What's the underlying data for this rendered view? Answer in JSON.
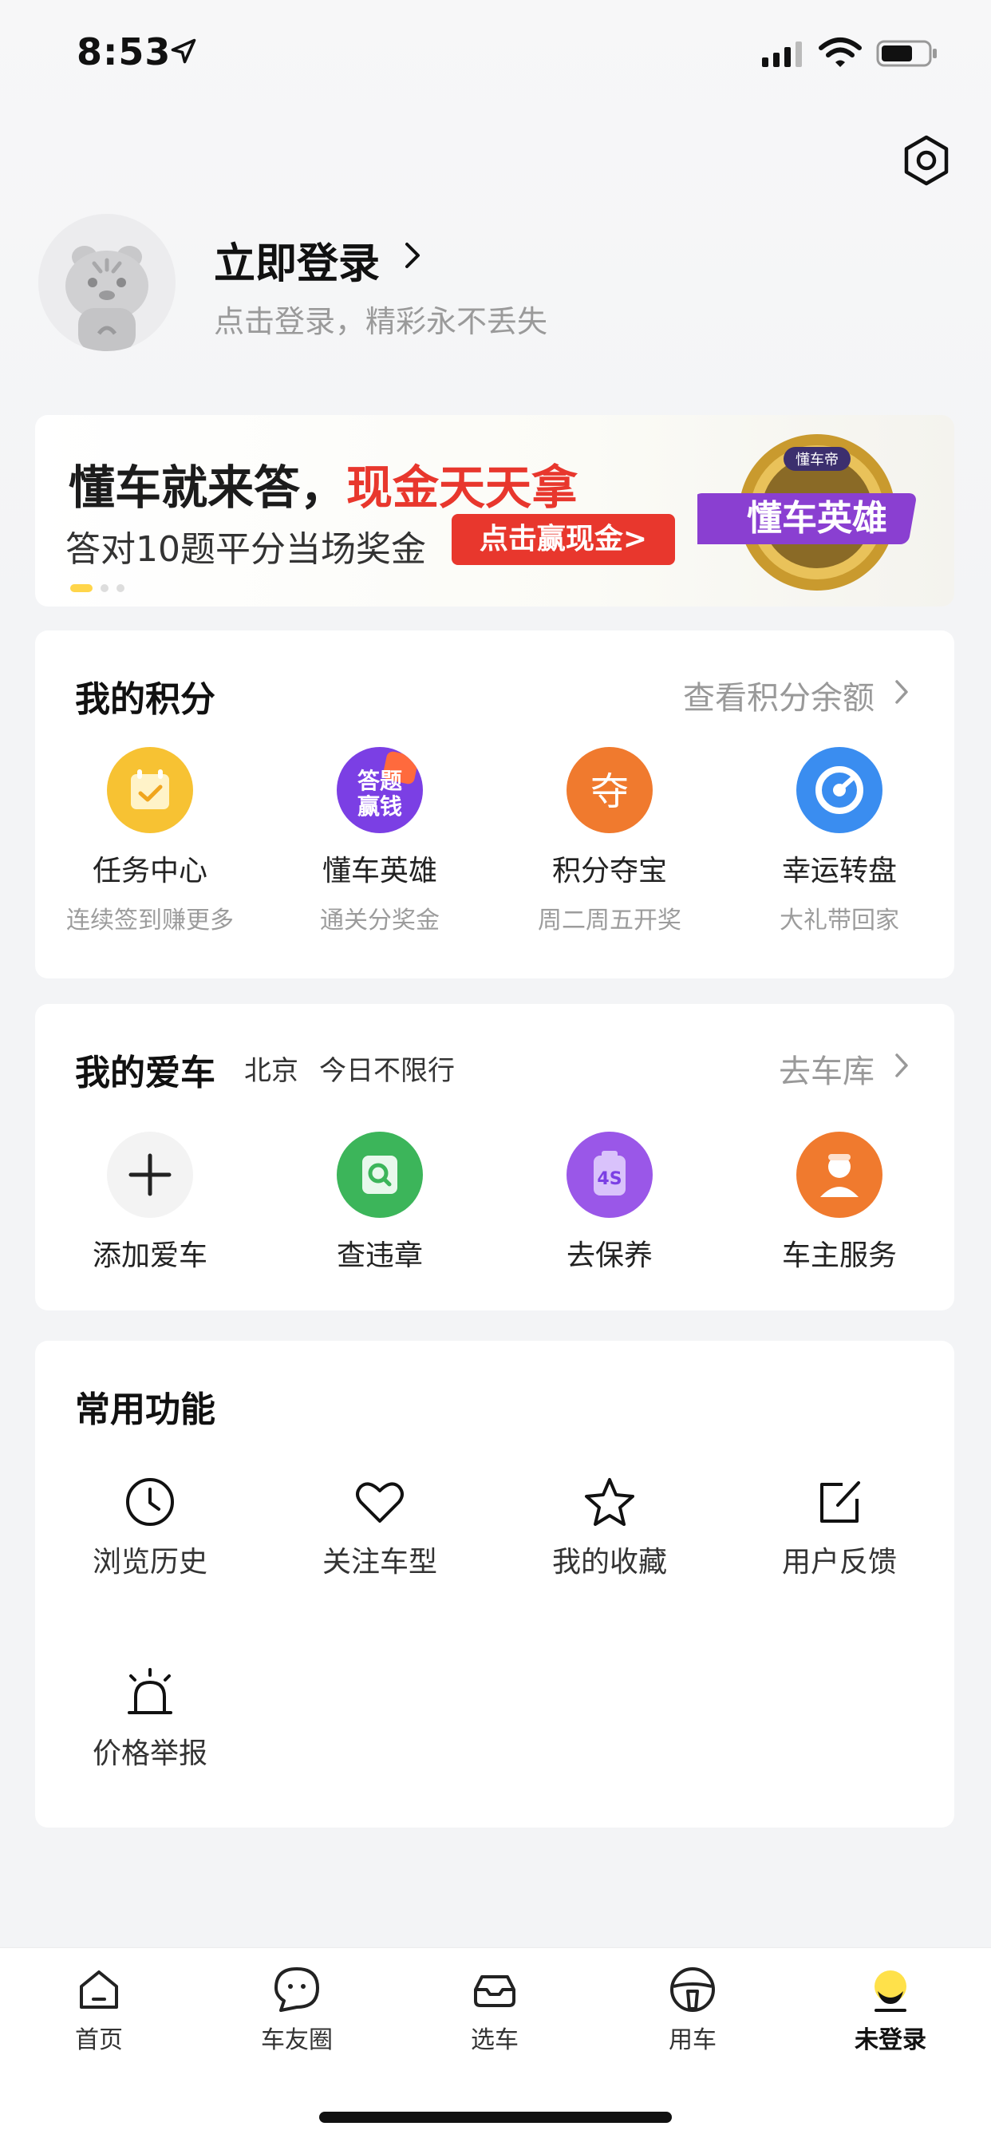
{
  "status_bar": {
    "time": "8:53"
  },
  "profile": {
    "login_title": "立即登录",
    "login_subtitle": "点击登录，精彩永不丢失"
  },
  "banner": {
    "title_part1": "懂车就来答，",
    "title_part2": "现金天天拿",
    "subtitle": "答对10题平分当场奖金",
    "button": "点击赢现金>",
    "badge_brand": "懂车帝",
    "badge_text": "懂车英雄"
  },
  "points": {
    "title": "我的积分",
    "link": "查看积分余额",
    "items": [
      {
        "label": "任务中心",
        "sub": "连续签到赚更多",
        "icon": "calendar-check-icon",
        "color": "#f7c233"
      },
      {
        "label": "懂车英雄",
        "sub": "通关分奖金",
        "icon": "quiz-money-icon",
        "icon_text": "答题赢钱",
        "color": "#7b3fe4"
      },
      {
        "label": "积分夺宝",
        "sub": "周二周五开奖",
        "icon": "treasure-icon",
        "icon_text": "夺",
        "color": "#f07a2e"
      },
      {
        "label": "幸运转盘",
        "sub": "大礼带回家",
        "icon": "wheel-icon",
        "color": "#3a8df0"
      }
    ]
  },
  "my_car": {
    "title": "我的爱车",
    "city": "北京",
    "restriction": "今日不限行",
    "link": "去车库",
    "items": [
      {
        "label": "添加爱车",
        "icon": "plus-icon",
        "color": "#f3f3f3"
      },
      {
        "label": "查违章",
        "icon": "search-violation-icon",
        "color": "#3cb55a"
      },
      {
        "label": "去保养",
        "icon": "maintenance-4s-icon",
        "icon_text": "4S",
        "color": "#9a57e8"
      },
      {
        "label": "车主服务",
        "icon": "owner-service-icon",
        "color": "#f07a2e"
      }
    ]
  },
  "common": {
    "title": "常用功能",
    "items": [
      {
        "label": "浏览历史",
        "icon": "clock-icon"
      },
      {
        "label": "关注车型",
        "icon": "heart-icon"
      },
      {
        "label": "我的收藏",
        "icon": "star-icon"
      },
      {
        "label": "用户反馈",
        "icon": "edit-icon"
      },
      {
        "label": "价格举报",
        "icon": "alarm-icon"
      }
    ]
  },
  "tabbar": {
    "items": [
      {
        "label": "首页",
        "icon": "home-icon"
      },
      {
        "label": "车友圈",
        "icon": "chat-icon"
      },
      {
        "label": "选车",
        "icon": "car-icon"
      },
      {
        "label": "用车",
        "icon": "steering-wheel-icon"
      },
      {
        "label": "未登录",
        "icon": "profile-moon-icon",
        "active": true
      }
    ]
  }
}
